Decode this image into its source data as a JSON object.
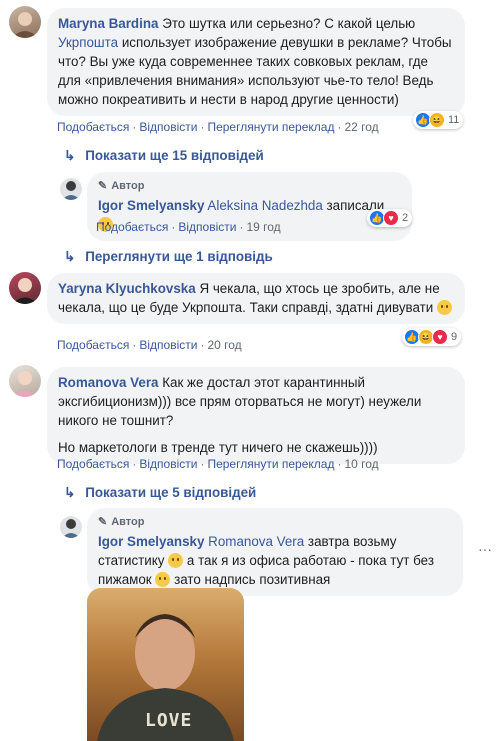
{
  "c1": {
    "author": "Maryna Bardina",
    "text1": " Это шутка или серьезно? С какой целью ",
    "mention": "Укрпошта",
    "text2": " использует изображение девушки в рекламе? Чтобы что? Вы уже куда современнее таких совковых реклам, где для «привлечения внимания» используют чье-то тело! Ведь можно покреативить и нести в народ другие ценности)",
    "like": "Подобається",
    "reply": "Відповісти",
    "translate": "Переглянути переклад",
    "time": "22 год",
    "reactions_count": "11"
  },
  "more1": "Показати ще 15 відповідей",
  "r1": {
    "badge": "Автор",
    "author": "Igor Smelyansky",
    "mention": "Aleksina Nadezhda",
    "text": " записали ",
    "like": "Подобається",
    "reply": "Відповісти",
    "time": "19 год",
    "reactions_count": "2"
  },
  "more2": "Переглянути ще 1 відповідь",
  "c2": {
    "author": "Yaryna Klyuchkovska",
    "text": " Я чекала, що хтось це зробить, але не чекала, що це буде Укрпошта. Таки справді, здатні дивувати ",
    "like": "Подобається",
    "reply": "Відповісти",
    "time": "20 год",
    "reactions_count": "9"
  },
  "c3": {
    "author": "Romanova Vera",
    "text1": " Как же достал этот карантинный эксгибиционизм))) все прям оторваться не могут) неужели никого не тошнит?",
    "text2": "Но маркетологи в тренде тут ничего не скажешь))))",
    "like": "Подобається",
    "reply": "Відповісти",
    "translate": "Переглянути переклад",
    "time": "10 год"
  },
  "more3": "Показати ще 5 відповідей",
  "r2": {
    "badge": "Автор",
    "author": "Igor Smelyansky",
    "mention": "Romanova Vera",
    "text1": " завтра возьму статистику ",
    "text2": " а так я из офиса работаю - пока тут без пижамок ",
    "text3": " зато надпись позитивная",
    "photo_text": "LOVE"
  },
  "colors": {
    "link": "#385898",
    "bubble": "#f2f3f5",
    "meta": "#606770"
  }
}
